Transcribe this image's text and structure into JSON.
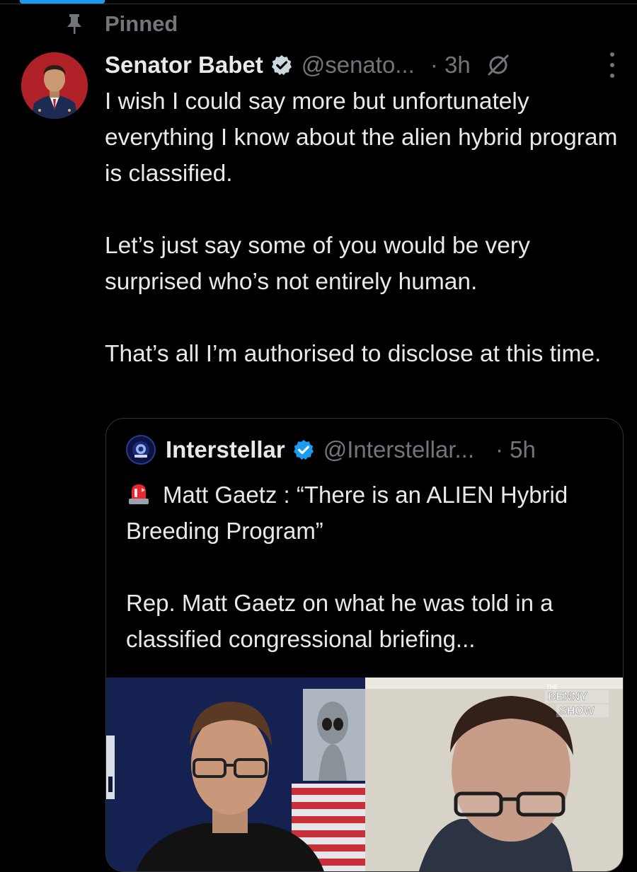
{
  "pinned": {
    "label": "Pinned"
  },
  "post": {
    "author_name": "Senator Babet",
    "handle": "@senato...",
    "time": "· 3h",
    "text": "I wish I could say more but unfortunately everything I know about the alien hybrid program is classified.\n\nLet’s just say some of you would be very surprised who’s not entirely human.\n\nThat’s all I’m authorised to disclose at this time."
  },
  "quote": {
    "author_name": "Interstellar",
    "handle": "@Interstellar...",
    "time": "· 5h",
    "headline": "Matt Gaetz : “There is an ALIEN Hybrid Breeding Program”",
    "body": "Rep. Matt Gaetz on what he was told in a classified congressional briefing...",
    "media": {
      "watermark_line1": "BENNY",
      "watermark_line2": "SHOW",
      "watermark_small": "THE"
    }
  },
  "colors": {
    "background": "#000000",
    "text": "#e7e9ea",
    "muted": "#71767b",
    "verified": "#1d9bf0",
    "border": "#2f3336"
  },
  "icons": [
    "pin-icon",
    "verified-badge-icon",
    "grok-icon",
    "more-icon",
    "siren-emoji-icon"
  ]
}
